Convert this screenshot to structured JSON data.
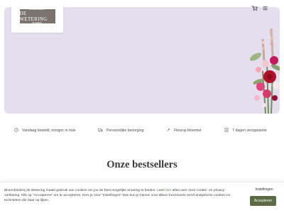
{
  "logo": {
    "top_line": "BLOEMBINDERIJ",
    "name": "DE WETERING",
    "bottom_line": "BLOEMEN"
  },
  "header": {
    "cart_icon": "cart-icon",
    "menu_icon": "menu-icon"
  },
  "usps": [
    {
      "icon": "clock-icon",
      "label": "Vandaag besteld, morgen in huis"
    },
    {
      "icon": "truck-icon",
      "label": "Persoonlijke bezorging"
    },
    {
      "icon": "flower-icon",
      "label": "Fleurop bloemist"
    },
    {
      "icon": "guarantee-icon",
      "label": "7 dagen versgarantie"
    }
  ],
  "section": {
    "title": "Onze bestsellers"
  },
  "cookie": {
    "text_before": "Bloembinderij de Wetering maakt gebruik van cookies om jou de best mogelijke ervaring te bieden. Lees ",
    "link": "hier",
    "text_after": " alles over onze cookie- en privacy verklaring. Klik op \"Accepteren\" om te accepteren. Kies je voor \"Instellingen\" Dan kun je kiezen voor alleen functionele en/of analytische cookies en technieken die daar op lijken.",
    "settings_label": "Instellingen",
    "accept_label": "Accepteren"
  },
  "colors": {
    "hero_bg": "#e5deef",
    "accept_bg": "#5d6b45"
  }
}
